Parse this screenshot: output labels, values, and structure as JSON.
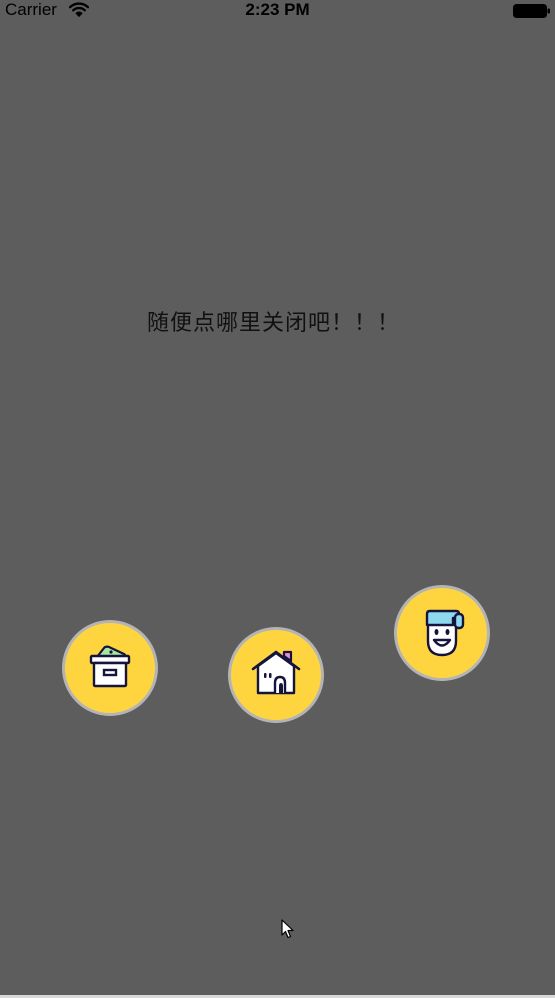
{
  "status_bar": {
    "carrier": "Carrier",
    "time": "2:23 PM"
  },
  "overlay": {
    "message": "随便点哪里关闭吧！！！",
    "background_color": "#5d5d5d"
  },
  "menu_items": [
    {
      "icon": "storage-box-icon"
    },
    {
      "icon": "home-icon"
    },
    {
      "icon": "smiley-face-icon"
    }
  ],
  "colors": {
    "button_fill": "#ffd53f",
    "button_border": "#b4b4b4",
    "icon_outline": "#14143c",
    "box_tag": "#a8e6a0",
    "house_chimney": "#f08cd2",
    "face_hair": "#8ed8f0"
  }
}
